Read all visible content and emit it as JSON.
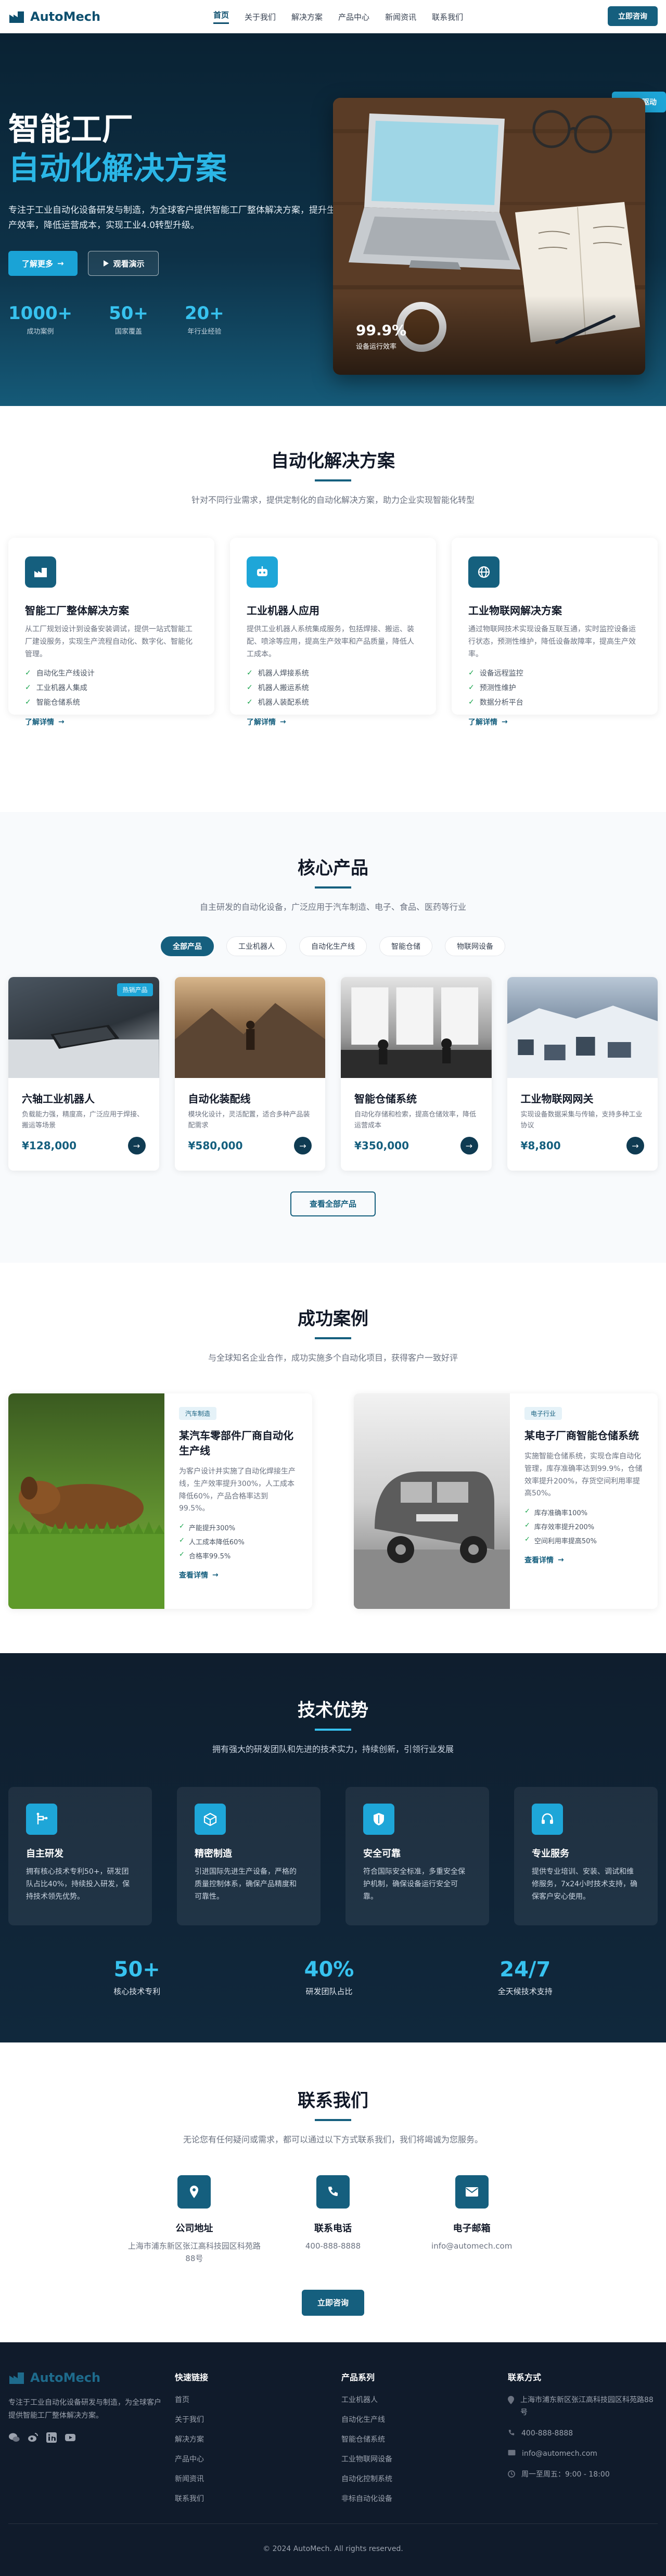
{
  "nav": {
    "brand": "AutoMech",
    "links": [
      "首页",
      "关于我们",
      "解决方案",
      "产品中心",
      "新闻资讯",
      "联系我们"
    ],
    "cta": "立即咨询"
  },
  "hero": {
    "title_line1": "智能工厂",
    "title_line2": "自动化解决方案",
    "description": "专注于工业自动化设备研发与制造，为全球客户提供智能工厂整体解决方案，提升生产效率，降低运营成本，实现工业4.0转型升级。",
    "btn_primary": "了解更多",
    "btn_secondary": "观看演示",
    "stats": [
      {
        "value": "1000+",
        "label": "成功案例"
      },
      {
        "value": "50+",
        "label": "国家覆盖"
      },
      {
        "value": "20+",
        "label": "年行业经验"
      }
    ],
    "badge": "AI驱动",
    "photo_stat": {
      "value": "99.9%",
      "label": "设备运行效率"
    }
  },
  "solutions": {
    "title": "自动化解决方案",
    "subtitle": "针对不同行业需求，提供定制化的自动化解决方案，助力企业实现智能化转型",
    "cards": [
      {
        "icon": "factory-icon",
        "title": "智能工厂整体解决方案",
        "desc": "从工厂规划设计到设备安装调试，提供一站式智能工厂建设服务，实现生产流程自动化、数字化、智能化管理。",
        "items": [
          "自动化生产线设计",
          "工业机器人集成",
          "智能仓储系统"
        ],
        "more": "了解详情"
      },
      {
        "icon": "robot-icon",
        "title": "工业机器人应用",
        "desc": "提供工业机器人系统集成服务，包括焊接、搬运、装配、喷涂等应用，提高生产效率和产品质量，降低人工成本。",
        "items": [
          "机器人焊接系统",
          "机器人搬运系统",
          "机器人装配系统"
        ],
        "more": "了解详情"
      },
      {
        "icon": "network-icon",
        "title": "工业物联网解决方案",
        "desc": "通过物联网技术实现设备互联互通，实时监控设备运行状态，预测性维护，降低设备故障率，提高生产效率。",
        "items": [
          "设备远程监控",
          "预测性维护",
          "数据分析平台"
        ],
        "more": "了解详情"
      }
    ]
  },
  "products": {
    "title": "核心产品",
    "subtitle": "自主研发的自动化设备，广泛应用于汽车制造、电子、食品、医药等行业",
    "filters": [
      "全部产品",
      "工业机器人",
      "自动化生产线",
      "智能仓储",
      "物联网设备"
    ],
    "items": [
      {
        "name": "六轴工业机器人",
        "desc": "负载能力强，精度高，广泛应用于焊接、搬运等场景",
        "price": "¥128,000",
        "tag": "热销产品"
      },
      {
        "name": "自动化装配线",
        "desc": "模块化设计，灵活配置，适合多种产品装配需求",
        "price": "¥580,000",
        "tag": ""
      },
      {
        "name": "智能仓储系统",
        "desc": "自动化存储和检索，提高仓储效率，降低运营成本",
        "price": "¥350,000",
        "tag": ""
      },
      {
        "name": "工业物联网网关",
        "desc": "实现设备数据采集与传输，支持多种工业协议",
        "price": "¥8,800",
        "tag": ""
      }
    ],
    "view_all": "查看全部产品"
  },
  "cases": {
    "title": "成功案例",
    "subtitle": "与全球知名企业合作，成功实施多个自动化项目，获得客户一致好评",
    "items": [
      {
        "tag": "汽车制造",
        "title": "某汽车零部件厂商自动化生产线",
        "desc": "为客户设计并实施了自动化焊接生产线，生产效率提升300%，人工成本降低60%，产品合格率达到99.5%。",
        "points": [
          "产能提升300%",
          "人工成本降低60%",
          "合格率99.5%"
        ],
        "more": "查看详情"
      },
      {
        "tag": "电子行业",
        "title": "某电子厂商智能仓储系统",
        "desc": "实施智能仓储系统，实现仓库自动化管理，库存准确率达到99.9%，仓储效率提升200%，存货空间利用率提高50%。",
        "points": [
          "库存准确率100%",
          "库存效率提升200%",
          "空间利用率提高50%"
        ],
        "more": "查看详情"
      }
    ]
  },
  "tech": {
    "title": "技术优势",
    "subtitle": "拥有强大的研发团队和先进的技术实力，持续创新，引领行业发展",
    "cards": [
      {
        "icon": "flow-icon",
        "title": "自主研发",
        "desc": "拥有核心技术专利50+，研发团队占比40%，持续投入研发，保持技术领先优势。"
      },
      {
        "icon": "cube-icon",
        "title": "精密制造",
        "desc": "引进国际先进生产设备，严格的质量控制体系，确保产品精度和可靠性。"
      },
      {
        "icon": "shield-icon",
        "title": "安全可靠",
        "desc": "符合国际安全标准，多重安全保护机制，确保设备运行安全可靠。"
      },
      {
        "icon": "headset-icon",
        "title": "专业服务",
        "desc": "提供专业培训、安装、调试和维修服务，7x24小时技术支持，确保客户安心使用。"
      }
    ],
    "stats": [
      {
        "value": "50+",
        "label": "核心技术专利"
      },
      {
        "value": "40%",
        "label": "研发团队占比"
      },
      {
        "value": "24/7",
        "label": "全天候技术支持"
      }
    ]
  },
  "contact": {
    "title": "联系我们",
    "subtitle": "无论您有任何疑问或需求，都可以通过以下方式联系我们，我们将竭诚为您服务。",
    "items": [
      {
        "icon": "location-icon",
        "title": "公司地址",
        "value": "上海市浦东新区张江高科技园区科苑路88号"
      },
      {
        "icon": "phone-icon",
        "title": "联系电话",
        "value": "400-888-8888"
      },
      {
        "icon": "mail-icon",
        "title": "电子邮箱",
        "value": "info@automech.com"
      }
    ],
    "cta": "立即咨询"
  },
  "footer": {
    "brand": "AutoMech",
    "desc": "专注于工业自动化设备研发与制造，为全球客户提供智能工厂整体解决方案。",
    "col_quick": {
      "title": "快速链接",
      "links": [
        "首页",
        "关于我们",
        "解决方案",
        "产品中心",
        "新闻资讯",
        "联系我们"
      ]
    },
    "col_products": {
      "title": "产品系列",
      "links": [
        "工业机器人",
        "自动化生产线",
        "智能仓储系统",
        "工业物联网设备",
        "自动化控制系统",
        "非标自动化设备"
      ]
    },
    "col_contact": {
      "title": "联系方式",
      "address": "上海市浦东新区张江高科技园区科苑路88号",
      "phone": "400-888-8888",
      "email": "info@automech.com",
      "hours": "周一至周五：9:00 - 18:00"
    },
    "copyright": "© 2024 AutoMech. All rights reserved."
  },
  "colors": {
    "brand": "#155f7e",
    "accent": "#1ea6d8",
    "hero_accent": "#2bb6e6",
    "dark": "#101b2b"
  }
}
